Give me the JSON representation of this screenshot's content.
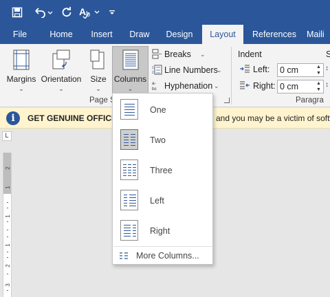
{
  "colors": {
    "brand": "#2b579a",
    "ribbon": "#f3f3f3",
    "banner": "#fff4ce"
  },
  "quick_access": {
    "save_icon": "save-icon",
    "undo_icon": "undo-icon",
    "redo_icon": "redo-icon",
    "spelling_icon": "spelling-icon",
    "customize_icon": "customize-icon"
  },
  "tabs": [
    {
      "label": "File"
    },
    {
      "label": "Home"
    },
    {
      "label": "Insert"
    },
    {
      "label": "Draw"
    },
    {
      "label": "Design"
    },
    {
      "label": "Layout"
    },
    {
      "label": "References"
    },
    {
      "label": "Maili"
    }
  ],
  "ribbon": {
    "margins": "Margins",
    "orientation": "Orientation",
    "size": "Size",
    "columns": "Columns",
    "breaks": "Breaks",
    "line_numbers": "Line Numbers",
    "hyphenation": "Hyphenation",
    "page_setup_group": "Page S",
    "indent_title": "Indent",
    "indent_left_label": "Left:",
    "indent_left_value": "0 cm",
    "indent_right_label": "Right:",
    "indent_right_value": "0 cm",
    "spacing_initial": "S",
    "paragraph_group": "Paragra"
  },
  "banner": {
    "icon": "info-icon",
    "title": "GET GENUINE OFFICE",
    "message": "and you may be a victim of softw"
  },
  "columns_menu": {
    "items": [
      {
        "label": "One"
      },
      {
        "label": "Two"
      },
      {
        "label": "Three"
      },
      {
        "label": "Left"
      },
      {
        "label": "Right"
      }
    ],
    "more_label": "More Columns..."
  },
  "ruler": {
    "numbers": [
      "2",
      "1",
      "1",
      "1",
      "2",
      "3"
    ]
  }
}
